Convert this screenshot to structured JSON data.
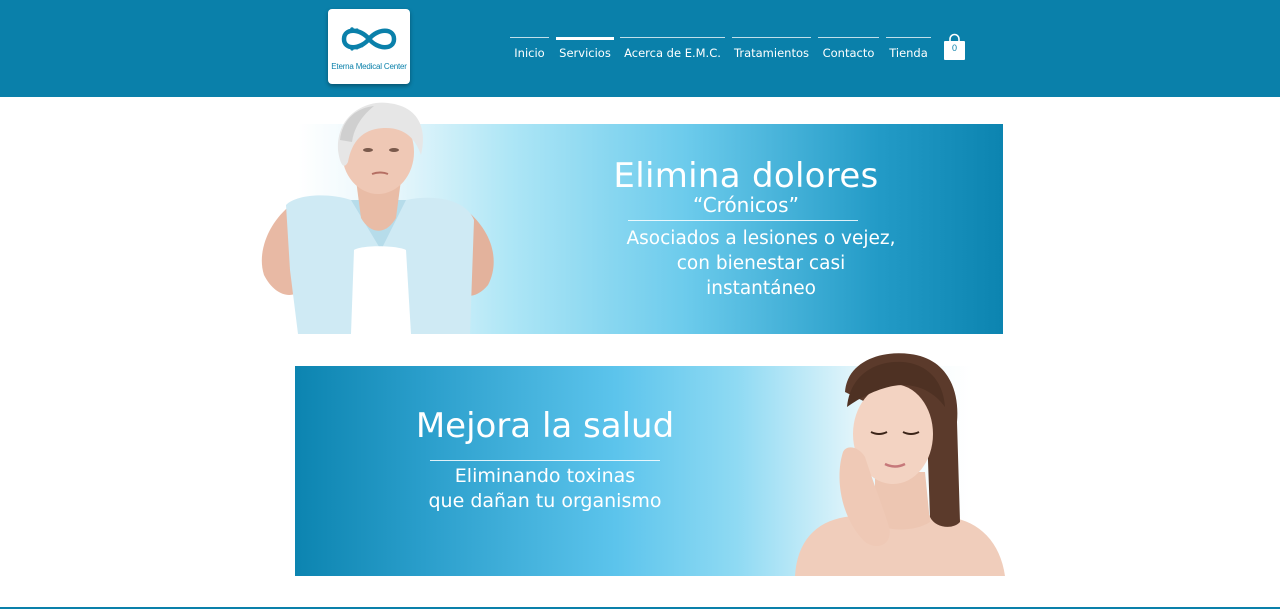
{
  "brand": {
    "logo_text": "Eterna Medical Center",
    "accent_color": "#0a80aa"
  },
  "nav": {
    "items": [
      {
        "label": "Inicio",
        "active": false
      },
      {
        "label": "Servicios",
        "active": true
      },
      {
        "label": "Acerca de E.M.C.",
        "active": false
      },
      {
        "label": "Tratamientos",
        "active": false
      },
      {
        "label": "Contacto",
        "active": false
      },
      {
        "label": "Tienda",
        "active": false
      }
    ]
  },
  "cart": {
    "icon": "shopping-bag-icon",
    "count": "0"
  },
  "banners": [
    {
      "title": "Elimina dolores",
      "subtitle": "“Crónicos”",
      "description_lines": [
        "Asociados a lesiones o vejez,",
        "con bienestar casi",
        "instantáneo"
      ],
      "image": "elderly-woman-back-pain-photo"
    },
    {
      "title": "Mejora la salud",
      "description_lines": [
        "Eliminando toxinas",
        "que dañan tu organismo"
      ],
      "image": "woman-skincare-portrait-photo"
    }
  ]
}
